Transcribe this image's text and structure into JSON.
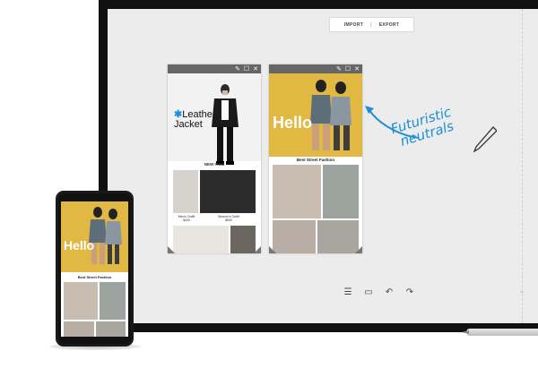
{
  "toolbar": {
    "import_label": "IMPORT",
    "separator": "|",
    "export_label": "EXPORT"
  },
  "card_left": {
    "heading_line1": "Leather",
    "heading_line2": "Jacket",
    "section_label": "NEW ITEM",
    "item_captions": [
      "Men's Outfit",
      "Women's Outfit"
    ],
    "item_prices": [
      "$400",
      "$500"
    ]
  },
  "card_right": {
    "hero_text": "Hello",
    "section_label": "Best Street Fashion"
  },
  "annotation": {
    "line1": "Futuristic",
    "line2": "neutrals"
  },
  "phone": {
    "hero_text": "Hello",
    "section_label": "Best Street Fashion"
  },
  "colors": {
    "accent": "#1d8fd6",
    "hero_yellow": "#e1b842",
    "card_bar": "#666666"
  },
  "icons": {
    "card_controls": [
      "edit-icon",
      "window-icon",
      "close-icon"
    ],
    "bottom_tools": [
      "menu-icon",
      "frame-icon",
      "undo-icon",
      "redo-icon"
    ],
    "resize": "resize-icon"
  }
}
